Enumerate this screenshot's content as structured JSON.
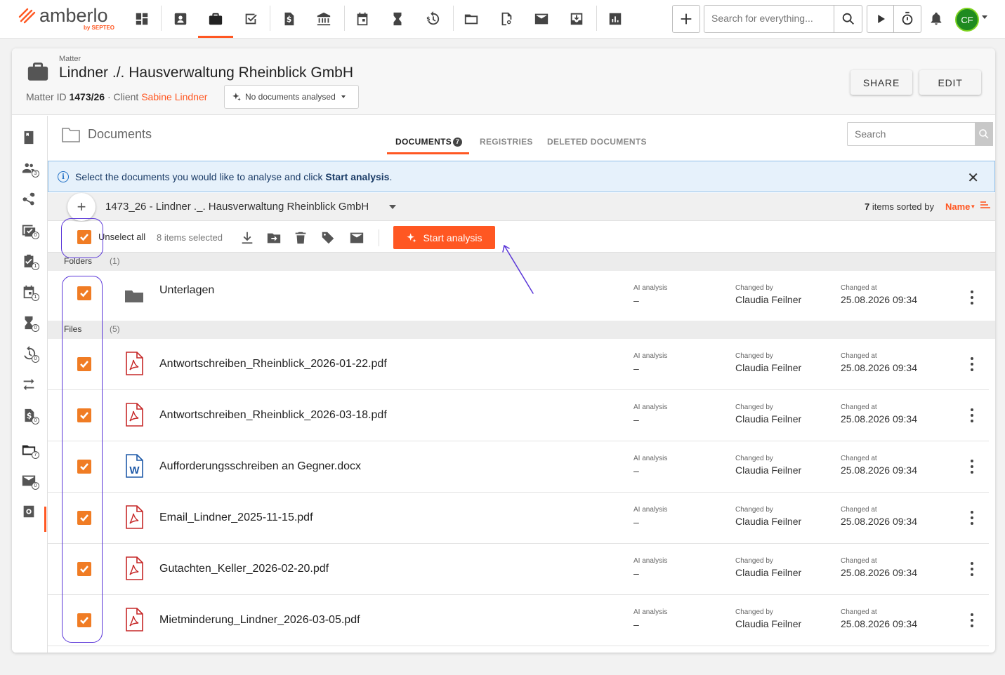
{
  "topbar": {
    "logo_text": "amberlo",
    "logo_sub": "by SEPTEO",
    "search_placeholder": "Search for everything...",
    "avatar_initials": "CF",
    "nav_icons": [
      "dashboard-icon",
      "contacts-icon",
      "matters-icon",
      "tasks-icon",
      "billing-icon",
      "bank-icon",
      "calendar-icon",
      "hourglass-icon",
      "time-money-icon",
      "folder-icon",
      "search-doc-icon",
      "mail-icon",
      "inbox-download-icon",
      "reports-icon"
    ]
  },
  "matter": {
    "type_label": "Matter",
    "title": "Lindner ./. Hausverwaltung Rheinblick GmbH",
    "id_label": "Matter ID",
    "id_value": "1473/26",
    "client_label": "Client",
    "client_name": "Sabine Lindner",
    "ai_status": "No documents analysed",
    "share_label": "SHARE",
    "edit_label": "EDIT"
  },
  "sidebar": {
    "items": [
      {
        "icon": "book-icon",
        "badge": ""
      },
      {
        "icon": "people-icon",
        "badge": "3"
      },
      {
        "icon": "share-icon",
        "badge": ""
      },
      {
        "icon": "tasks-check-icon",
        "badge": "0"
      },
      {
        "icon": "clipboard-check-icon",
        "badge": "1"
      },
      {
        "icon": "calendar-icon",
        "badge": "1"
      },
      {
        "icon": "hourglass-icon",
        "badge": "0"
      },
      {
        "icon": "time-money-icon",
        "badge": "0"
      },
      {
        "icon": "transfer-icon",
        "badge": ""
      },
      {
        "icon": "invoice-icon",
        "badge": "0"
      },
      {
        "icon": "folder-icon",
        "badge": "7"
      },
      {
        "icon": "mail-icon",
        "badge": "0"
      },
      {
        "icon": "settings-icon",
        "badge": ""
      }
    ]
  },
  "documents": {
    "title": "Documents",
    "tabs": [
      {
        "label": "DOCUMENTS",
        "badge": "7"
      },
      {
        "label": "REGISTRIES",
        "badge": ""
      },
      {
        "label": "DELETED DOCUMENTS",
        "badge": ""
      }
    ],
    "search_placeholder": "Search",
    "info_text_pre": "Select the documents you would like to analyse and click ",
    "info_text_bold": "Start analysis",
    "info_text_post": ".",
    "path": "1473_26 - Lindner ._. Hausverwaltung Rheinblick GmbH",
    "items_count": "7",
    "sorted_by_text": " items sorted by ",
    "sort_field": "Name",
    "unselect_all": "Unselect all",
    "selected_count": "8 items selected",
    "start_analysis": "Start analysis",
    "folders_label": "Folders",
    "folders_count": "(1)",
    "files_label": "Files",
    "files_count": "(5)",
    "col_ai": "AI analysis",
    "col_changed_by": "Changed by",
    "col_changed_at": "Changed at",
    "folders": [
      {
        "name": "Unterlagen",
        "ai": "–",
        "changed_by": "Claudia Feilner",
        "changed_at": "25.08.2026 09:34"
      }
    ],
    "files": [
      {
        "name": "Antwortschreiben_Rheinblick_2026-01-22.pdf",
        "type": "pdf",
        "ai": "–",
        "changed_by": "Claudia Feilner",
        "changed_at": "25.08.2026 09:34"
      },
      {
        "name": "Antwortschreiben_Rheinblick_2026-03-18.pdf",
        "type": "pdf",
        "ai": "–",
        "changed_by": "Claudia Feilner",
        "changed_at": "25.08.2026 09:34"
      },
      {
        "name": "Aufforderungsschreiben an Gegner.docx",
        "type": "docx",
        "ai": "–",
        "changed_by": "Claudia Feilner",
        "changed_at": "25.08.2026 09:34"
      },
      {
        "name": "Email_Lindner_2025-11-15.pdf",
        "type": "pdf",
        "ai": "–",
        "changed_by": "Claudia Feilner",
        "changed_at": "25.08.2026 09:34"
      },
      {
        "name": "Gutachten_Keller_2026-02-20.pdf",
        "type": "pdf",
        "ai": "–",
        "changed_by": "Claudia Feilner",
        "changed_at": "25.08.2026 09:34"
      },
      {
        "name": "Mietminderung_Lindner_2026-03-05.pdf",
        "type": "pdf",
        "ai": "–",
        "changed_by": "Claudia Feilner",
        "changed_at": "25.08.2026 09:34"
      }
    ]
  },
  "colors": {
    "accent": "#ff5722",
    "checkbox": "#f07c24",
    "annotation": "#5a36d8",
    "info_bg": "#e6f1fb"
  }
}
